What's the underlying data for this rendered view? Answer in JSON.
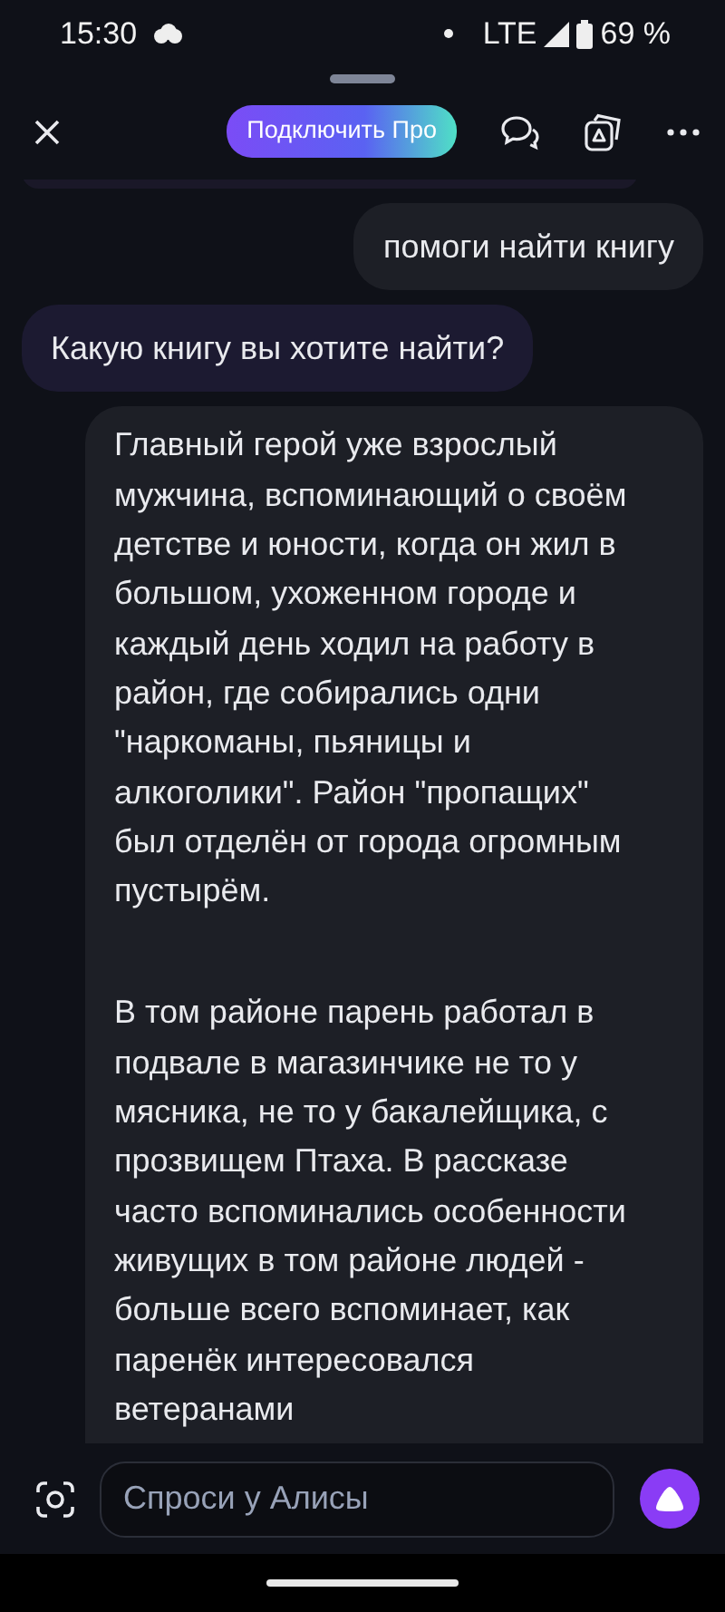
{
  "status_bar": {
    "time": "15:30",
    "network": "LTE",
    "battery": "69 %"
  },
  "top_bar": {
    "pro_button": "Подключить Про"
  },
  "messages": [
    {
      "kind": "fragment"
    },
    {
      "kind": "text",
      "outgoing": true,
      "paragraphs": [
        "помоги найти книгу"
      ]
    },
    {
      "kind": "text",
      "outgoing": false,
      "paragraphs": [
        "Какую книгу вы хотите найти?"
      ]
    },
    {
      "kind": "text",
      "outgoing": true,
      "paragraphs": [
        "Главный герой уже взрослый мужчина, вспоминающий о своём детстве и юности, когда он жил в большом, ухоженном городе и каждый день ходил на работу в район, где собирались одни \"наркоманы, пьяницы и алкоголики\". Район \"пропащих\" был отделён от города огромным пустырём.",
        "В том районе парень работал в подвале в магазинчике не то у мясника, не то у бакалейщика, с прозвищем Птаха. В рассказе часто вспоминались особенности живущих в том районе людей - больше всего вспоминает, как паренёк интересовался ветеранами"
      ]
    }
  ],
  "input": {
    "placeholder": "Спроси у Алисы"
  }
}
